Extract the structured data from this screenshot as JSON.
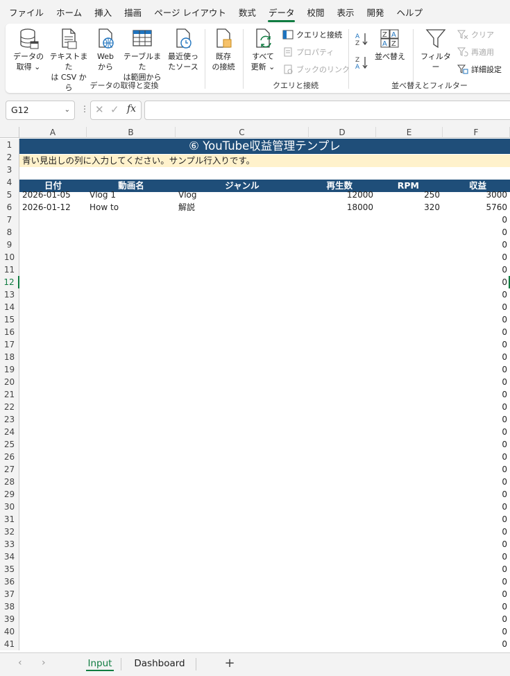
{
  "menu": [
    "ファイル",
    "ホーム",
    "挿入",
    "描画",
    "ページ レイアウト",
    "数式",
    "データ",
    "校閲",
    "表示",
    "開発",
    "ヘルプ"
  ],
  "ribbon": {
    "get_data": {
      "line1": "データの",
      "line2": "取得 ⌄"
    },
    "from_text": {
      "line1": "テキストまた",
      "line2": "は CSV から"
    },
    "from_web": {
      "line1": "Web",
      "line2": "から"
    },
    "from_table": {
      "line1": "テーブルまた",
      "line2": "は範囲から"
    },
    "recent": {
      "line1": "最近使っ",
      "line2": "たソース"
    },
    "existing": {
      "line1": "既存",
      "line2": "の接続"
    },
    "refresh_all": {
      "line1": "すべて",
      "line2": "更新 ⌄"
    },
    "queries_connections": "クエリと接続",
    "properties": "プロパティ",
    "edit_links": "ブックのリンク",
    "sort": "並べ替え",
    "filter": "フィルター",
    "clear": "クリア",
    "reapply": "再適用",
    "advanced": "詳細設定",
    "group_get": "データの取得と変換",
    "group_query": "クエリと接続",
    "group_sort": "並べ替えとフィルター"
  },
  "formula": {
    "name_box": "G12",
    "fx": "fx",
    "value": ""
  },
  "columns": [
    "A",
    "B",
    "C",
    "D",
    "E",
    "F"
  ],
  "rows_visible": 41,
  "selected_row": 12,
  "sheet": {
    "title": "⑥ YouTube収益管理テンプレ",
    "note": "青い見出しの列に入力してください。サンプル行入りです。",
    "headers": [
      "日付",
      "動画名",
      "ジャンル",
      "再生数",
      "RPM",
      "収益"
    ],
    "data_rows": [
      {
        "date": "2026-01-05",
        "name": "Vlog 1",
        "genre": "Vlog",
        "views": "12000",
        "rpm": "250",
        "revenue": "3000"
      },
      {
        "date": "2026-01-12",
        "name": "How to",
        "genre": "解説",
        "views": "18000",
        "rpm": "320",
        "revenue": "5760"
      }
    ],
    "zero_value": "0"
  },
  "tabs": {
    "input": "Input",
    "dashboard": "Dashboard",
    "add": "+"
  },
  "colors": {
    "accent": "#107c41",
    "header_blue": "#1f4e79",
    "note_yellow": "#fff2cc"
  }
}
